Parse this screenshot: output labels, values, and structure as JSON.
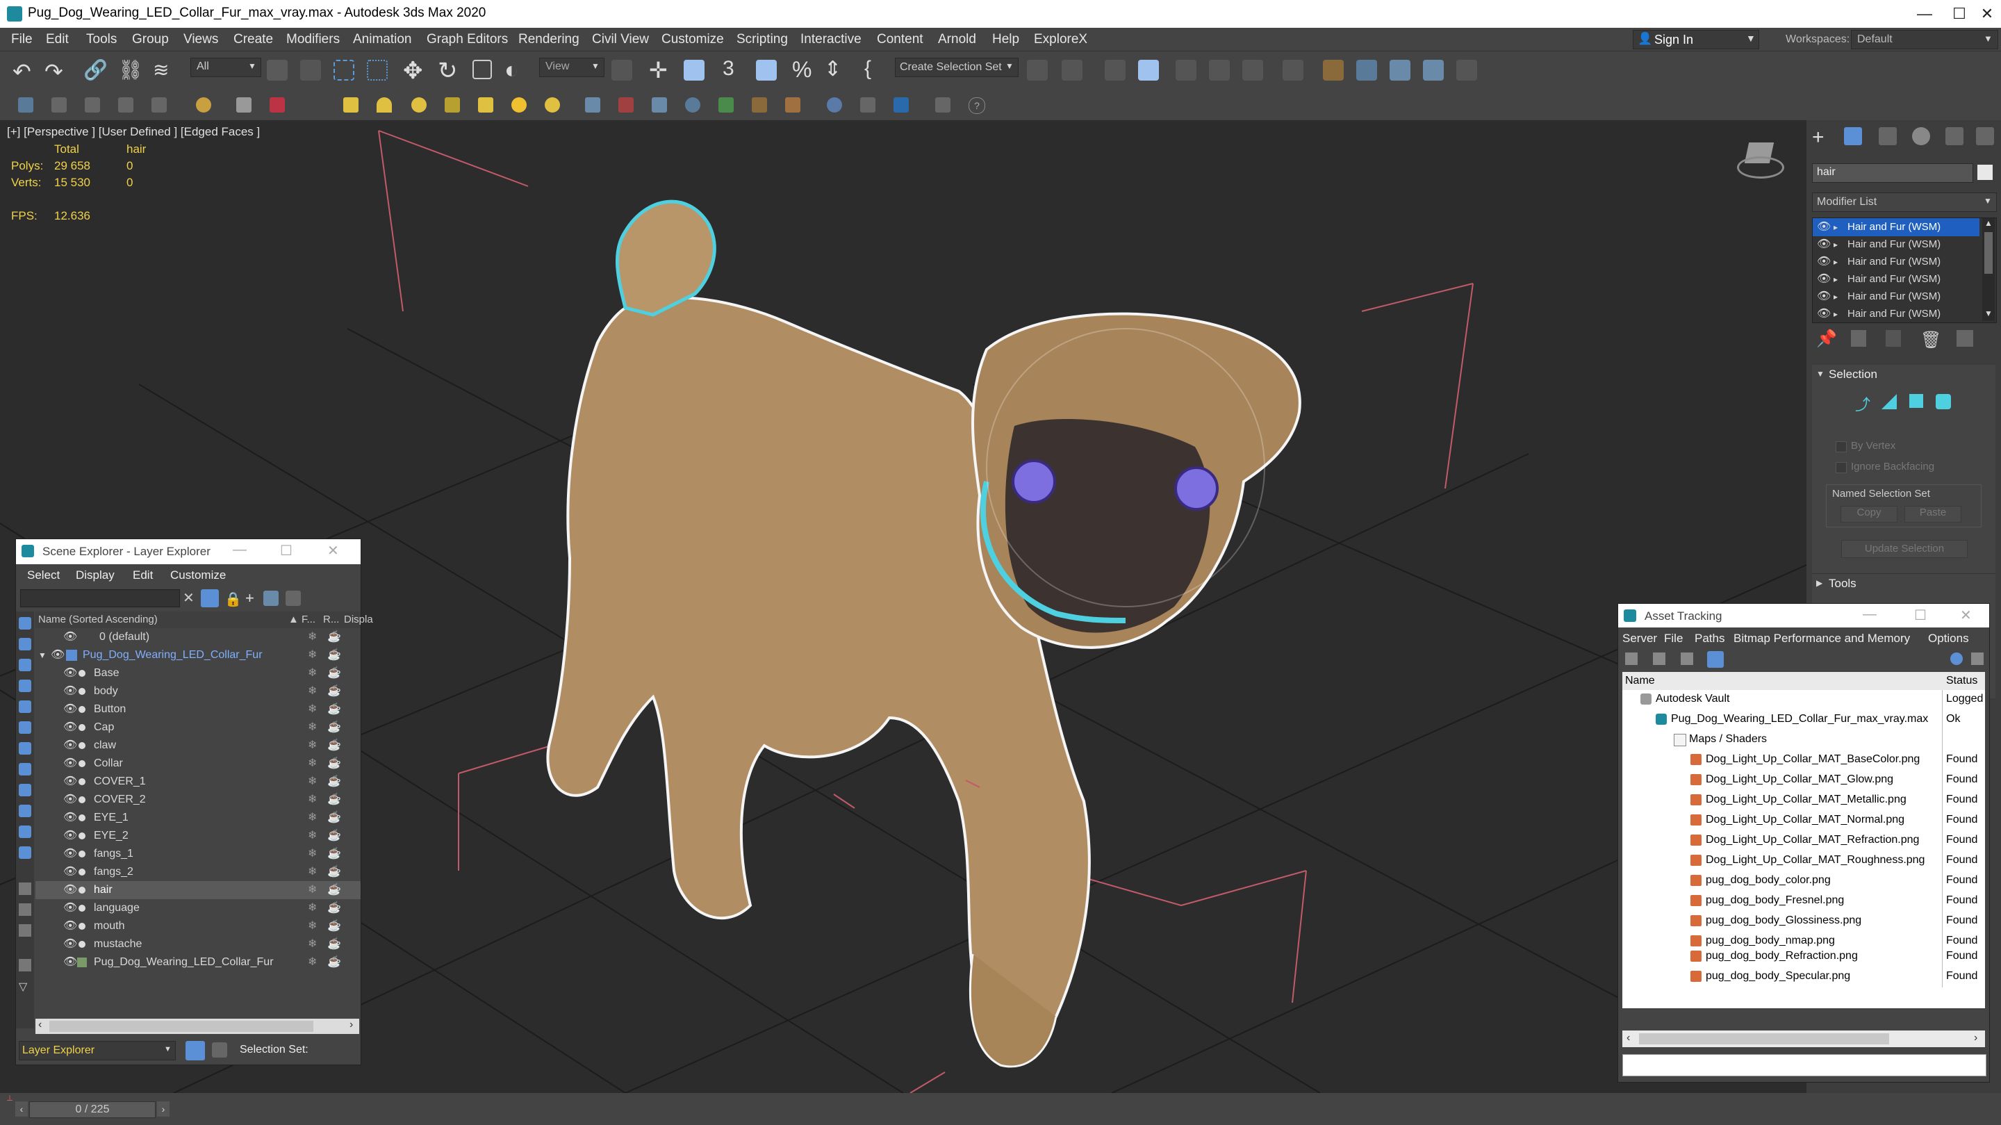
{
  "window": {
    "title": "Pug_Dog_Wearing_LED_Collar_Fur_max_vray.max - Autodesk 3ds Max 2020"
  },
  "menu": [
    "File",
    "Edit",
    "Tools",
    "Group",
    "Views",
    "Create",
    "Modifiers",
    "Animation",
    "Graph Editors",
    "Rendering",
    "Civil View",
    "Customize",
    "Scripting",
    "Interactive",
    "Content",
    "Arnold",
    "Help",
    "ExploreX"
  ],
  "account": {
    "sign_in": "Sign In",
    "workspaces_label": "Workspaces:",
    "workspace": "Default"
  },
  "toolbar": {
    "filter": "All",
    "view": "View",
    "selection_set": "Create Selection Set"
  },
  "viewport": {
    "label": "[+] [Perspective ] [User Defined ] [Edged Faces ]",
    "stats": {
      "col_total": "Total",
      "col_sel": "hair",
      "polys_label": "Polys:",
      "polys_total": "29 658",
      "polys_sel": "0",
      "verts_label": "Verts:",
      "verts_total": "15 530",
      "verts_sel": "0",
      "fps_label": "FPS:",
      "fps": "12.636"
    }
  },
  "command_panel": {
    "object_name": "hair",
    "modifier_list": "Modifier List",
    "modifiers": [
      "Hair and Fur (WSM)",
      "Hair and Fur (WSM)",
      "Hair and Fur (WSM)",
      "Hair and Fur (WSM)",
      "Hair and Fur (WSM)",
      "Hair and Fur (WSM)"
    ],
    "selection_title": "Selection",
    "by_vertex": "By Vertex",
    "ignore_backfacing": "Ignore Backfacing",
    "named_selection_set": "Named Selection Set",
    "copy": "Copy",
    "paste": "Paste",
    "update_selection": "Update Selection",
    "tools_title": "Tools"
  },
  "scene_explorer": {
    "title": "Scene Explorer - Layer Explorer",
    "menu": [
      "Select",
      "Display",
      "Edit",
      "Customize"
    ],
    "col_name": "Name (Sorted Ascending)",
    "col_f": "▲ F...",
    "col_r": "R...",
    "col_display": "Displa",
    "rows": [
      "0 (default)",
      "Pug_Dog_Wearing_LED_Collar_Fur",
      "Base",
      "body",
      "Button",
      "Cap",
      "claw",
      "Collar",
      "COVER_1",
      "COVER_2",
      "EYE_1",
      "EYE_2",
      "fangs_1",
      "fangs_2",
      "hair",
      "language",
      "mouth",
      "mustache",
      "Pug_Dog_Wearing_LED_Collar_Fur"
    ],
    "footer_label": "Layer Explorer",
    "selection_set": "Selection Set:"
  },
  "asset_tracking": {
    "title": "Asset Tracking",
    "menu": [
      "Server",
      "File",
      "Paths",
      "Bitmap Performance and Memory",
      "Options"
    ],
    "col_name": "Name",
    "col_status": "Status",
    "rows": [
      {
        "name": "Autodesk Vault",
        "status": "Logged"
      },
      {
        "name": "Pug_Dog_Wearing_LED_Collar_Fur_max_vray.max",
        "status": "Ok"
      },
      {
        "name": "Maps / Shaders",
        "status": ""
      },
      {
        "name": "Dog_Light_Up_Collar_MAT_BaseColor.png",
        "status": "Found"
      },
      {
        "name": "Dog_Light_Up_Collar_MAT_Glow.png",
        "status": "Found"
      },
      {
        "name": "Dog_Light_Up_Collar_MAT_Metallic.png",
        "status": "Found"
      },
      {
        "name": "Dog_Light_Up_Collar_MAT_Normal.png",
        "status": "Found"
      },
      {
        "name": "Dog_Light_Up_Collar_MAT_Refraction.png",
        "status": "Found"
      },
      {
        "name": "Dog_Light_Up_Collar_MAT_Roughness.png",
        "status": "Found"
      },
      {
        "name": "pug_dog_body_color.png",
        "status": "Found"
      },
      {
        "name": "pug_dog_body_Fresnel.png",
        "status": "Found"
      },
      {
        "name": "pug_dog_body_Glossiness.png",
        "status": "Found"
      },
      {
        "name": "pug_dog_body_nmap.png",
        "status": "Found"
      },
      {
        "name": "pug_dog_body_Refraction.png",
        "status": "Found"
      },
      {
        "name": "pug_dog_body_Specular.png",
        "status": "Found"
      }
    ]
  },
  "timeline": {
    "frame": "0 / 225"
  },
  "colors": {
    "accent": "#5b8fd6",
    "selection_blue": "#1f5fbf",
    "stat_yellow": "#f0d24a"
  }
}
